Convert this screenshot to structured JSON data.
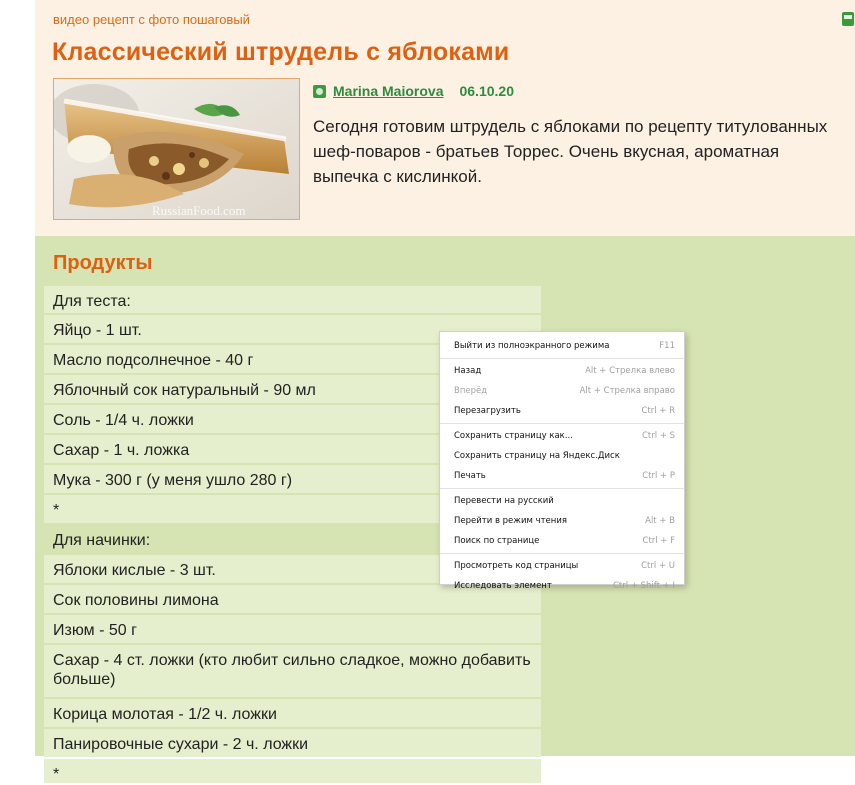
{
  "recipe": {
    "subtitle": "видео рецепт с фото пошаговый",
    "title": "Классический штрудель с яблоками",
    "photo_watermark": "RussianFood.com",
    "author": "Marina Maiorova",
    "date": "06.10.20",
    "description": "Сегодня готовим штрудель с яблоками по рецепту титулованных шеф-поваров - братьев Торрес. Очень вкусная, ароматная выпечка с кислинкой."
  },
  "products": {
    "title": "Продукты",
    "items": [
      "Для теста:",
      "Яйцо - 1 шт.",
      "Масло подсолнечное - 40 г",
      "Яблочный сок натуральный - 90 мл",
      "Соль - 1/4 ч. ложки",
      "Сахар - 1 ч. ложка",
      "Мука - 300 г (у меня ушло 280 г)",
      "*",
      "Для начинки:",
      "Яблоки кислые - 3 шт.",
      "Сок половины лимона",
      "Изюм - 50 г",
      "Сахар - 4 ст. ложки (кто любит сильно сладкое, можно добавить больше)",
      "Корица молотая - 1/2 ч. ложки",
      "Панировочные сухари - 2 ч. ложки",
      "*"
    ]
  },
  "context_menu": {
    "items": [
      {
        "label": "Выйти из полноэкранного режима",
        "shortcut": "F11"
      },
      {
        "label": "Назад",
        "shortcut": "Alt + Стрелка влево"
      },
      {
        "label": "Вперёд",
        "shortcut": "Alt + Стрелка вправо"
      },
      {
        "label": "Перезагрузить",
        "shortcut": "Ctrl + R"
      },
      {
        "label": "Сохранить страницу как...",
        "shortcut": "Ctrl + S"
      },
      {
        "label": "Сохранить страницу на Яндекс.Диск",
        "shortcut": ""
      },
      {
        "label": "Печать",
        "shortcut": "Ctrl + P"
      },
      {
        "label": "Перевести на русский",
        "shortcut": ""
      },
      {
        "label": "Перейти в режим чтения",
        "shortcut": "Alt + B"
      },
      {
        "label": "Поиск по странице",
        "shortcut": "Ctrl + F"
      },
      {
        "label": "Просмотреть код страницы",
        "shortcut": "Ctrl + U"
      },
      {
        "label": "Исследовать элемент",
        "shortcut": "Ctrl + Shift + I"
      }
    ]
  },
  "icons": {
    "print": "printer-icon",
    "author": "user-icon"
  },
  "colors": {
    "accent": "#de6010",
    "link": "#2e8b3e",
    "header_bg": "#fdf1e4",
    "products_bg": "#d6e3b2",
    "row_light": "#e6efcd"
  }
}
